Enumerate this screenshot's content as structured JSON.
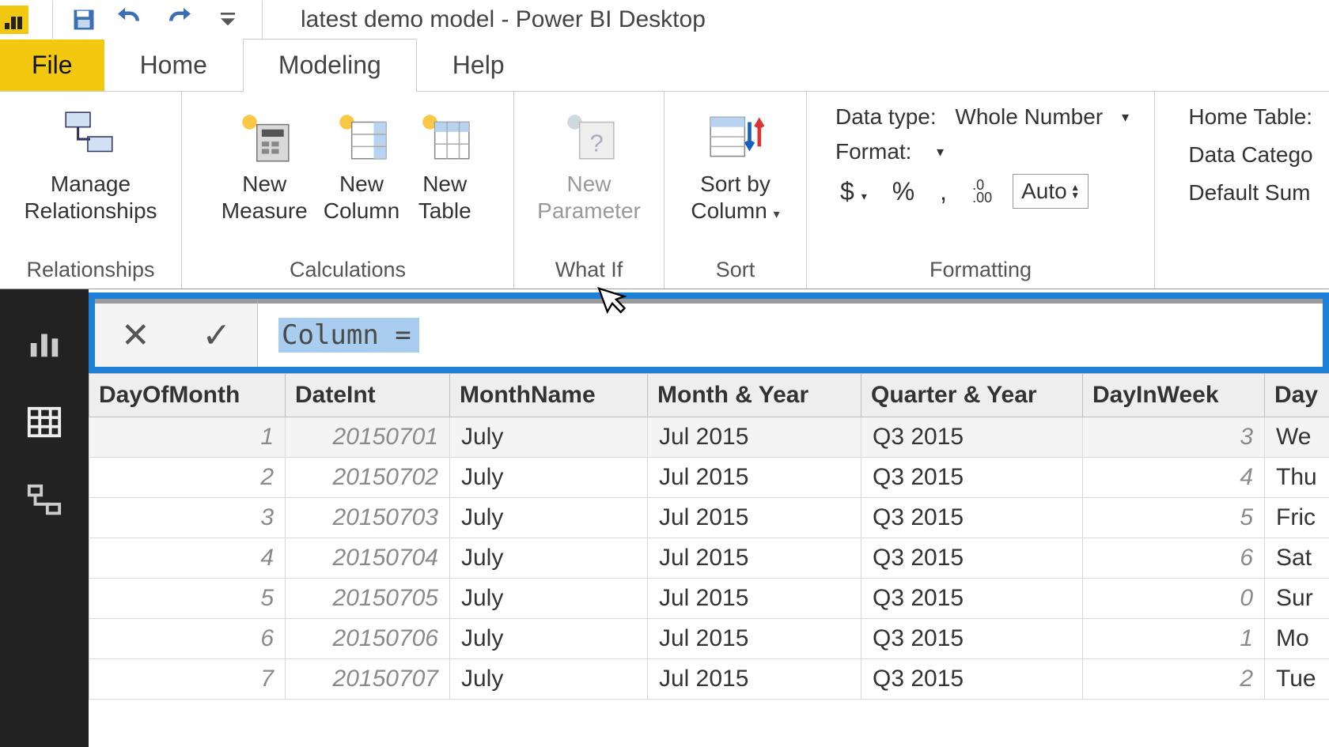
{
  "title": "latest demo model - Power BI Desktop",
  "tabs": {
    "file": "File",
    "home": "Home",
    "modeling": "Modeling",
    "help": "Help"
  },
  "ribbon": {
    "groups": {
      "relationships": {
        "label": "Relationships",
        "manage": "Manage\nRelationships"
      },
      "calculations": {
        "label": "Calculations",
        "new_measure": "New\nMeasure",
        "new_column": "New\nColumn",
        "new_table": "New\nTable"
      },
      "whatif": {
        "label": "What If",
        "new_parameter": "New\nParameter"
      },
      "sort": {
        "label": "Sort",
        "sort_by_column": "Sort by\nColumn"
      },
      "formatting": {
        "label": "Formatting",
        "data_type_label": "Data type:",
        "data_type_value": "Whole Number",
        "format_label": "Format:",
        "currency": "$",
        "percent": "%",
        "comma": ",",
        "decimal_icon": ".0 .00",
        "decimals_value": "Auto"
      },
      "properties": {
        "home_table": "Home Table:",
        "data_category": "Data Catego",
        "default_sum": "Default Sum"
      }
    }
  },
  "formula": {
    "text": "Column ="
  },
  "grid": {
    "columns": [
      "DayOfMonth",
      "DateInt",
      "MonthName",
      "Month & Year",
      "Quarter & Year",
      "DayInWeek",
      "Day"
    ],
    "rows": [
      {
        "DayOfMonth": "1",
        "DateInt": "20150701",
        "MonthName": "July",
        "MonthYear": "Jul 2015",
        "QuarterYear": "Q3 2015",
        "DayInWeek": "3",
        "DayName": "We"
      },
      {
        "DayOfMonth": "2",
        "DateInt": "20150702",
        "MonthName": "July",
        "MonthYear": "Jul 2015",
        "QuarterYear": "Q3 2015",
        "DayInWeek": "4",
        "DayName": "Thu"
      },
      {
        "DayOfMonth": "3",
        "DateInt": "20150703",
        "MonthName": "July",
        "MonthYear": "Jul 2015",
        "QuarterYear": "Q3 2015",
        "DayInWeek": "5",
        "DayName": "Fric"
      },
      {
        "DayOfMonth": "4",
        "DateInt": "20150704",
        "MonthName": "July",
        "MonthYear": "Jul 2015",
        "QuarterYear": "Q3 2015",
        "DayInWeek": "6",
        "DayName": "Sat"
      },
      {
        "DayOfMonth": "5",
        "DateInt": "20150705",
        "MonthName": "July",
        "MonthYear": "Jul 2015",
        "QuarterYear": "Q3 2015",
        "DayInWeek": "0",
        "DayName": "Sur"
      },
      {
        "DayOfMonth": "6",
        "DateInt": "20150706",
        "MonthName": "July",
        "MonthYear": "Jul 2015",
        "QuarterYear": "Q3 2015",
        "DayInWeek": "1",
        "DayName": "Mo"
      },
      {
        "DayOfMonth": "7",
        "DateInt": "20150707",
        "MonthName": "July",
        "MonthYear": "Jul 2015",
        "QuarterYear": "Q3 2015",
        "DayInWeek": "2",
        "DayName": "Tue"
      }
    ]
  }
}
